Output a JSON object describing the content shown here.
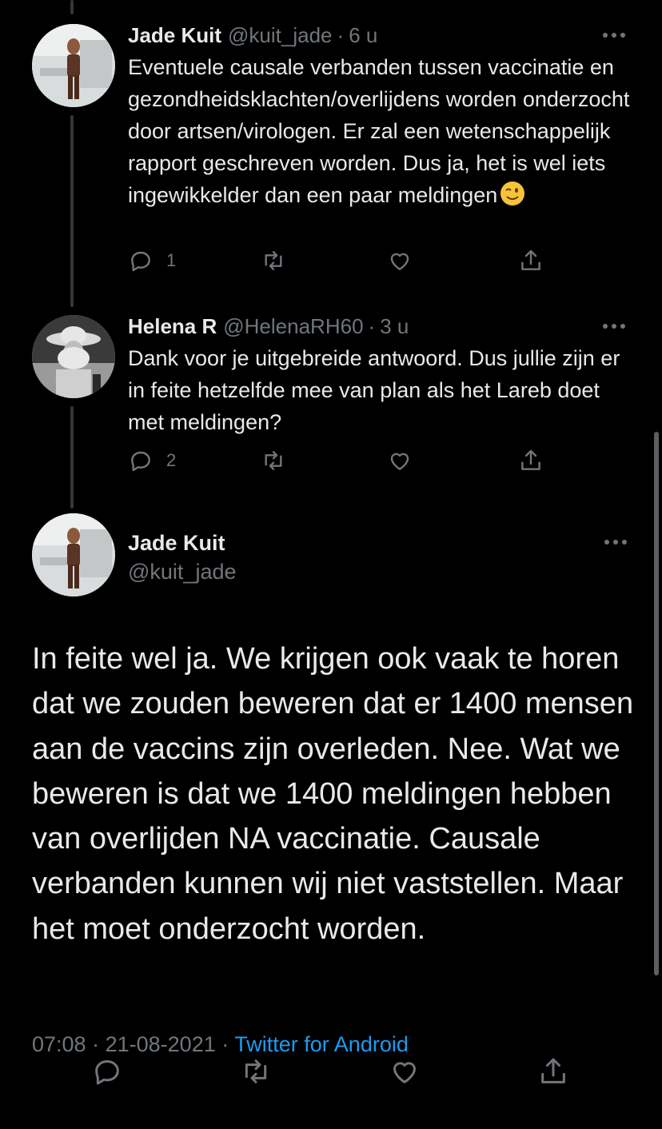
{
  "thread": [
    {
      "name": "Jade Kuit",
      "handle": "@kuit_jade",
      "separator": "·",
      "time": "6 u",
      "text": "Eventuele causale verbanden tussen vaccinatie en gezondheidsklachten/overlijdens worden onderzocht door artsen/virologen. Er zal een wetenschappelijk rapport geschreven worden. Dus ja, het is wel iets ingewikkelder dan een paar meldingen",
      "emoji": "winking-face",
      "reply_count": "1",
      "retweet_count": "",
      "like_count": ""
    },
    {
      "name": "Helena R",
      "handle": "@HelenaRH60",
      "separator": "·",
      "time": "3 u",
      "text": "Dank voor je uitgebreide antwoord. Dus jullie zijn er in feite hetzelfde mee van plan als het Lareb doet met meldingen?",
      "reply_count": "2",
      "retweet_count": "",
      "like_count": ""
    }
  ],
  "main_tweet": {
    "name": "Jade Kuit",
    "handle": "@kuit_jade",
    "text": "In feite wel ja. We krijgen ook vaak te horen dat we zouden beweren dat er 1400 mensen aan de vaccins zijn overleden. Nee. Wat we beweren is dat we 1400 meldingen hebben van overlijden NA vaccinatie. Causale verbanden kunnen wij niet vaststellen. Maar het moet onderzocht worden.",
    "time": "07:08",
    "date": "21-08-2021",
    "separator": "·",
    "source": "Twitter for Android"
  },
  "icons": [
    "more-icon",
    "reply-icon",
    "retweet-icon",
    "like-icon",
    "share-icon"
  ],
  "colors": {
    "background": "#000000",
    "text": "#e7e9ea",
    "secondary": "#71767b",
    "link": "#1d9bf0",
    "thread_line": "#333639"
  }
}
